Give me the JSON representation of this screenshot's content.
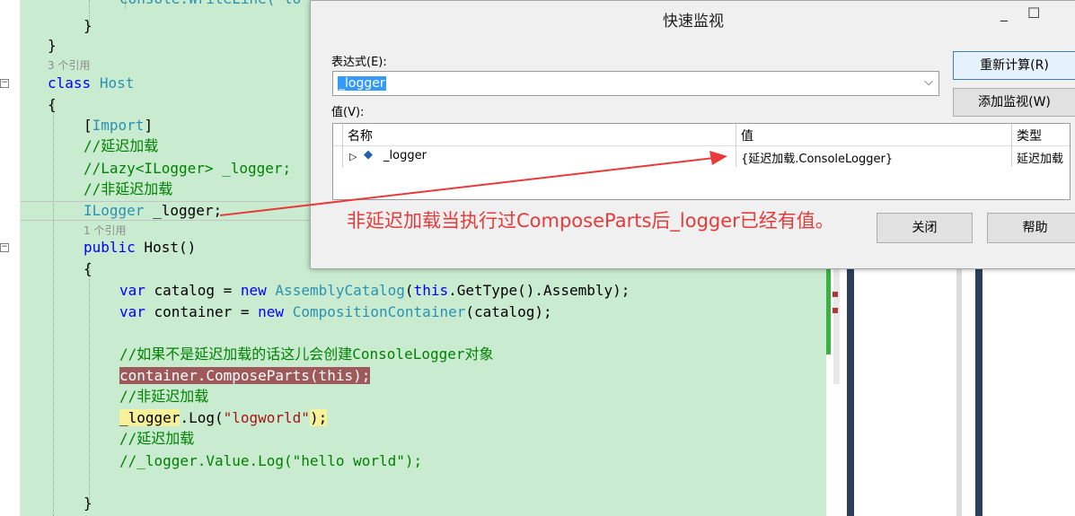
{
  "editor": {
    "ref_count_3": "3 个引用",
    "ref_count_1": "1 个引用",
    "line0": "Console.WriteLine(\"lo",
    "close_brace": "}",
    "open_brace": "{",
    "kw_class": "class",
    "class_name": "Host",
    "attr_open": "[",
    "attr_name": "Import",
    "attr_close": "]",
    "comment_lazy": "//延迟加载",
    "comment_lazy_code": "//Lazy<ILogger> _logger;",
    "comment_nonlazy": "//非延迟加载",
    "field_type": "ILogger",
    "field_name": " _logger;",
    "kw_public": "public",
    "ctor": " Host()",
    "kw_var": "var",
    "catalog_decl": " catalog = ",
    "kw_new": "new",
    "type_catalog": "AssemblyCatalog",
    "paren_open": "(",
    "kw_this": "this",
    "catalog_rest": ".GetType().Assembly);",
    "container_decl": " container = ",
    "type_container": "CompositionContainer",
    "container_rest": "(catalog);",
    "comment_create": "//如果不是延迟加载的话这儿会创建ConsoleLogger对象",
    "compose_call": "container.ComposeParts(this);",
    "comment_nonlazy2": "//非延迟加载",
    "logger_var": "_logger",
    "log_call": ".Log(",
    "log_str": "\"logworld\"",
    "log_end": ");",
    "comment_lazy2": "//延迟加载",
    "comment_value_log": "//_logger.Value.Log(\"hello world\");"
  },
  "dialog": {
    "title": "快速监视",
    "minimize": "_",
    "maximize": "☐",
    "expression_label": "表达式(E):",
    "expression_value": "_logger",
    "value_label": "值(V):",
    "recalc_button": "重新计算(R)",
    "add_watch_button": "添加监视(W)",
    "close_button": "关闭",
    "help_button": "帮助",
    "columns": [
      "名称",
      "值",
      "类型"
    ],
    "row": {
      "name": "_logger",
      "value": "{延迟加载.ConsoleLogger}",
      "type": "延迟加载"
    }
  },
  "annotation": "非延迟加载当执行过ComposeParts后_logger已经有值。",
  "colors": {
    "annotation": "#e83a3a",
    "editor_bg": "#c9ecd0",
    "keyword": "#0000ff",
    "type": "#2b91af",
    "comment": "#008000"
  }
}
